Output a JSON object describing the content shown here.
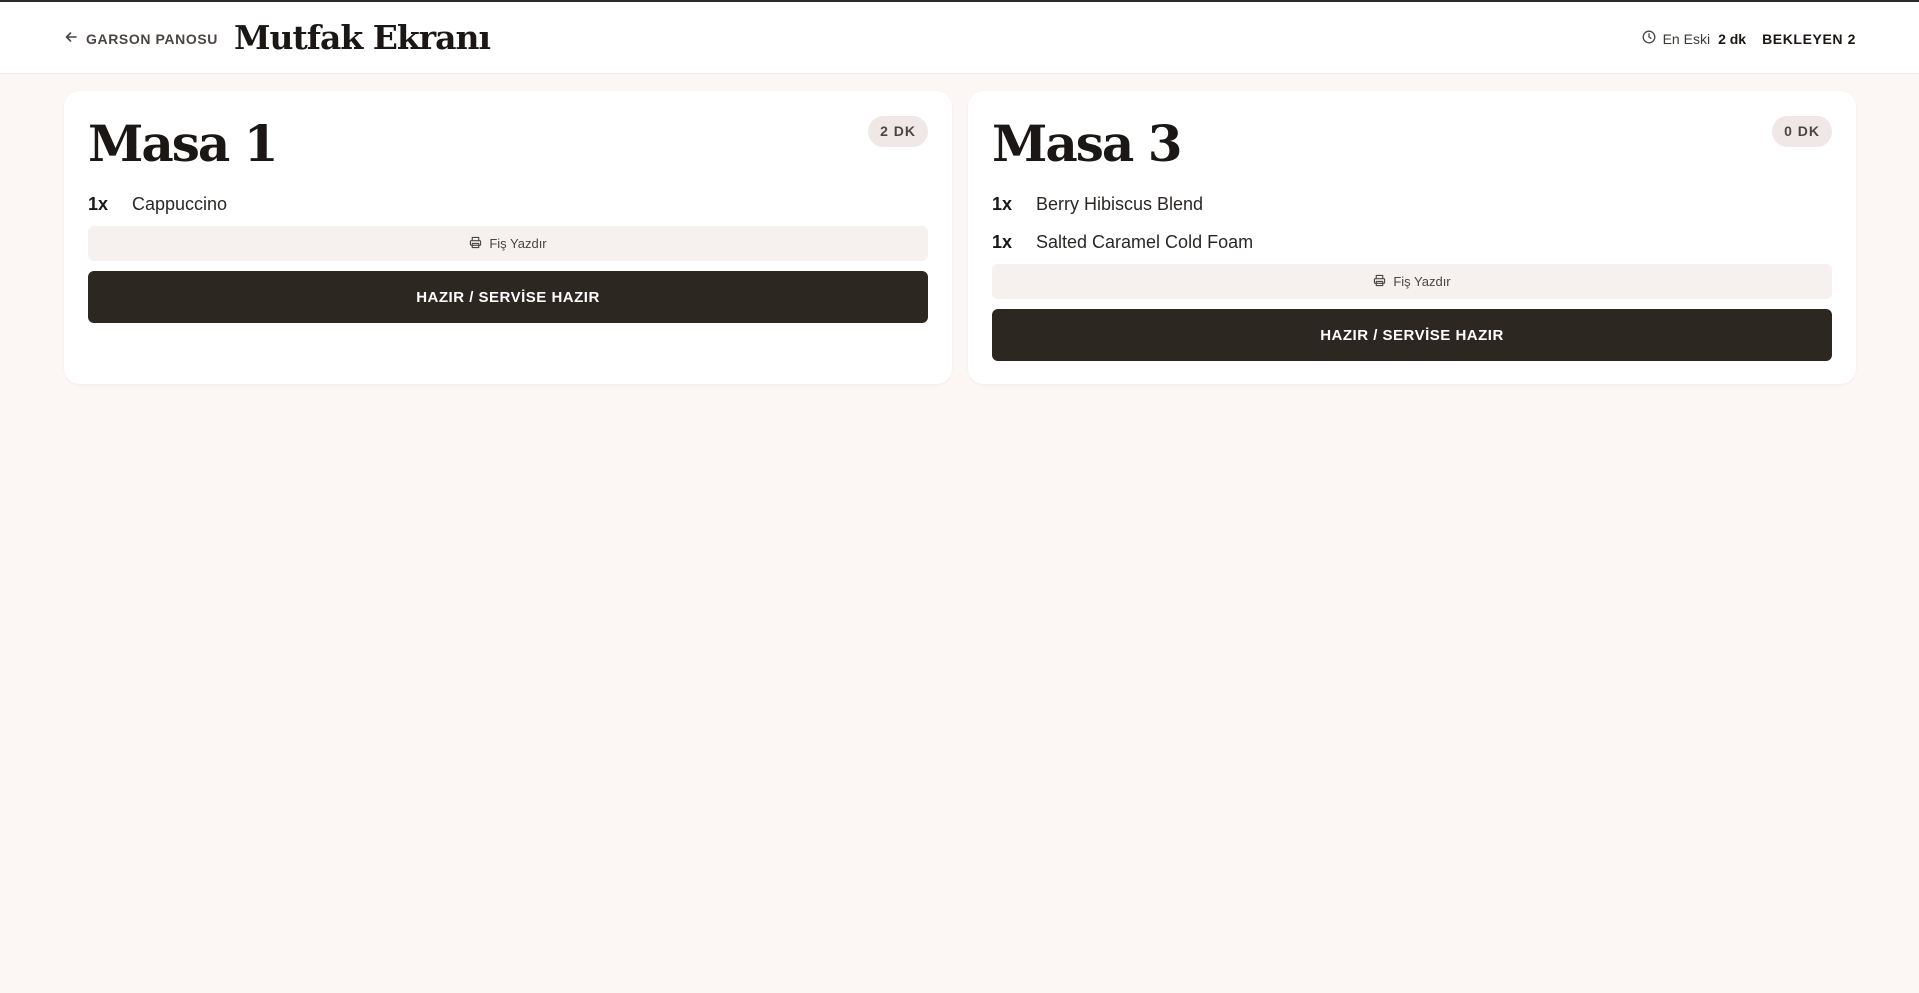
{
  "header": {
    "back_label": "GARSON PANOSU",
    "title": "Mutfak Ekranı",
    "oldest_label": "En Eski",
    "oldest_value": "2 dk",
    "pending_label": "BEKLEYEN 2"
  },
  "orders": [
    {
      "table": "Masa 1",
      "elapsed": "2 DK",
      "items": [
        {
          "qty": "1x",
          "name": "Cappuccino"
        }
      ],
      "print_label": "Fiş Yazdır",
      "ready_label": "HAZIR / SERVİSE HAZIR"
    },
    {
      "table": "Masa 3",
      "elapsed": "0 DK",
      "items": [
        {
          "qty": "1x",
          "name": "Berry Hibiscus Blend"
        },
        {
          "qty": "1x",
          "name": "Salted Caramel Cold Foam"
        }
      ],
      "print_label": "Fiş Yazdır",
      "ready_label": "HAZIR / SERVİSE HAZIR"
    }
  ],
  "icons": {
    "back": "arrow-left-icon",
    "clock": "clock-icon",
    "print": "printer-icon"
  },
  "colors": {
    "background": "#fcf6f5",
    "button_dark": "#2d2722",
    "badge": "#efe8e7",
    "print_button": "#f6f0ef"
  }
}
